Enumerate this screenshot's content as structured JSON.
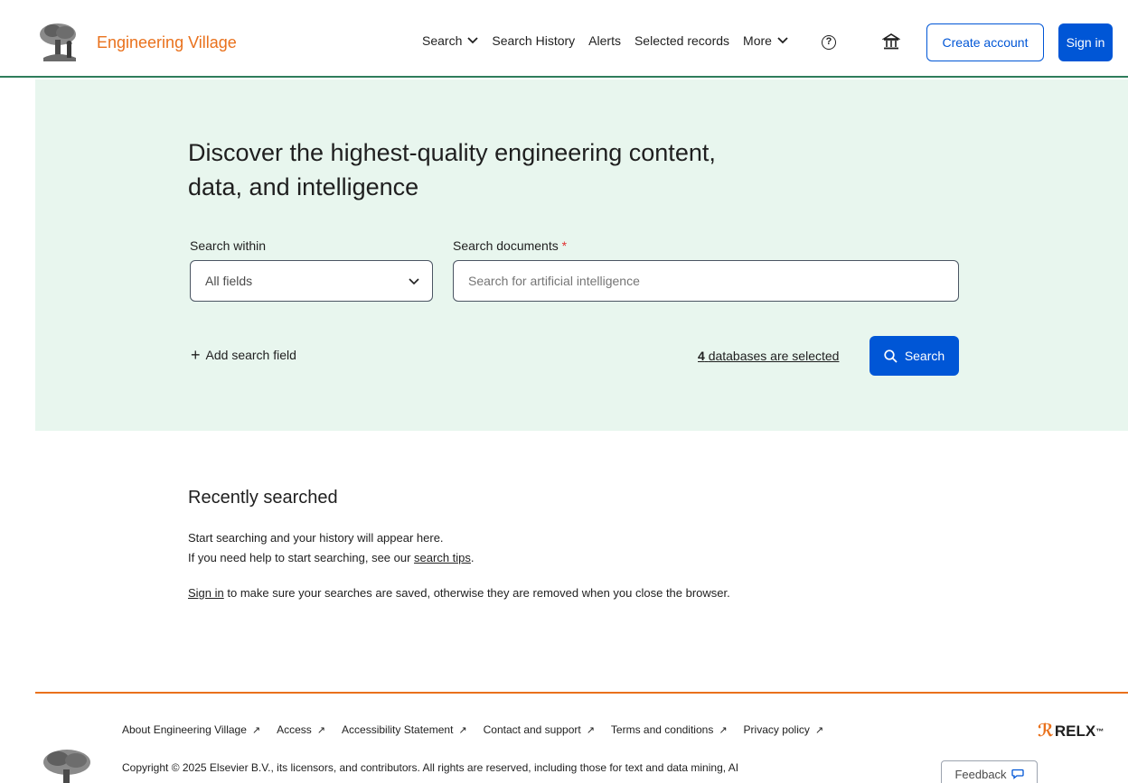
{
  "header": {
    "brand": "Engineering Village",
    "nav": [
      {
        "label": "Search",
        "has_dropdown": true
      },
      {
        "label": "Search History",
        "has_dropdown": false
      },
      {
        "label": "Alerts",
        "has_dropdown": false
      },
      {
        "label": "Selected records",
        "has_dropdown": false
      },
      {
        "label": "More",
        "has_dropdown": true
      }
    ],
    "help_icon": "?",
    "institution_icon": "institution-icon",
    "create_account_label": "Create account",
    "sign_in_label": "Sign in"
  },
  "hero": {
    "title": "Discover the highest-quality engineering content, data, and intelligence",
    "search_within_label": "Search within",
    "search_within_value": "All fields",
    "search_documents_label": "Search documents",
    "required_mark": "*",
    "search_placeholder": "Search for artificial intelligence",
    "add_field_label": "Add search field",
    "databases_count": "4",
    "databases_text": "databases are selected",
    "search_button_label": "Search"
  },
  "recent": {
    "title": "Recently searched",
    "line1": "Start searching and your history will appear here.",
    "line2_prefix": "If you need help to start searching, see our ",
    "line2_link": "search tips",
    "line2_suffix": ".",
    "line3_link": "Sign in",
    "line3_suffix": " to make sure your searches are saved, otherwise they are removed when you close the browser."
  },
  "footer": {
    "links": [
      "About Engineering Village",
      "Access",
      "Accessibility Statement",
      "Contact and support",
      "Terms and conditions",
      "Privacy policy"
    ],
    "external_arrow": "↗",
    "relx_label": "RELX",
    "relx_tm": "™",
    "copyright": "Copyright © 2025 Elsevier B.V., its licensors, and contributors. All rights are reserved, including those for text and data mining, AI",
    "feedback_label": "Feedback"
  },
  "colors": {
    "brand_orange": "#e9711c",
    "primary_blue": "#0056d6",
    "hero_bg": "#e8f6ee",
    "header_rule": "#2e7d5b"
  }
}
